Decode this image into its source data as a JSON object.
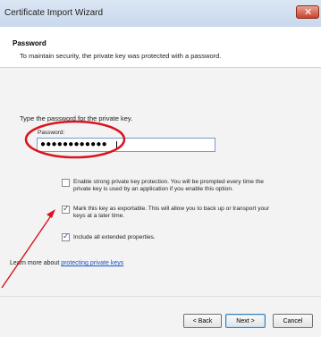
{
  "window": {
    "title": "Certificate Import Wizard"
  },
  "header": {
    "title": "Password",
    "description": "To maintain security, the private key was protected with a password."
  },
  "form": {
    "prompt": "Type the password for the private key.",
    "password_label": "Password:",
    "password_value": "●●●●●●●●●●●●"
  },
  "options": [
    {
      "checked": false,
      "text_line1": "Enable strong private key protection. You will be prompted every time the",
      "text_line2": "private key is used by an application if you enable this option."
    },
    {
      "checked": true,
      "text_line1": "Mark this key as exportable. This will allow you to back up or transport your",
      "text_line2": "keys at a later time."
    },
    {
      "checked": true,
      "text_line1": "Include all extended properties.",
      "text_line2": ""
    }
  ],
  "learn_more": {
    "prefix": "Learn more about ",
    "link": "protecting private keys"
  },
  "buttons": {
    "back": "< Back",
    "next": "Next >",
    "cancel": "Cancel"
  },
  "icons": {
    "close": "close-icon",
    "checkmark": "checkmark-icon"
  },
  "colors": {
    "annotation": "#d9141e",
    "link": "#1a55c5"
  }
}
